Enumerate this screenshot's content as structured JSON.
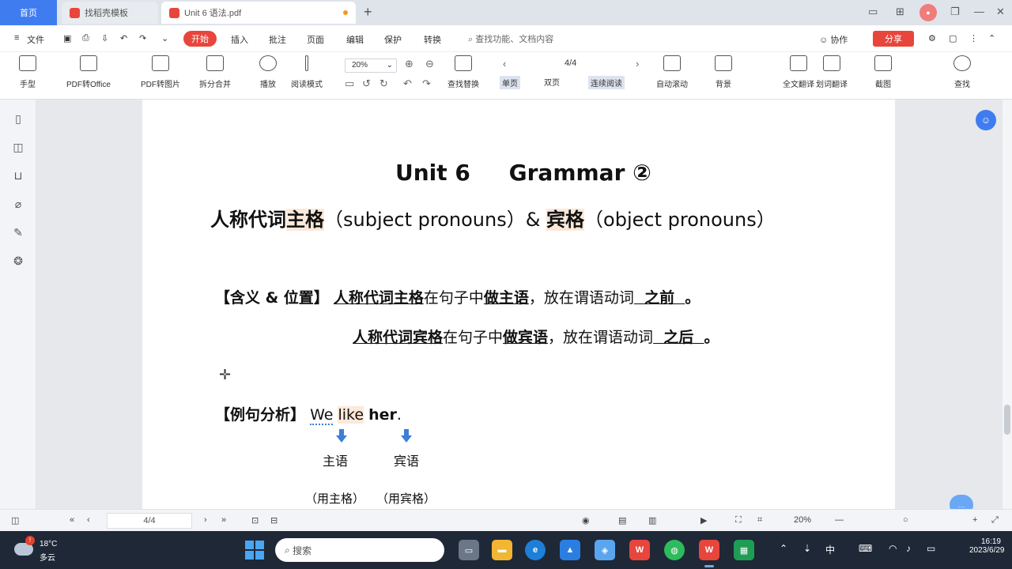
{
  "tabs": [
    {
      "label": "首页"
    },
    {
      "label": "找稻壳模板"
    },
    {
      "label": "Unit 6 语法.pdf"
    }
  ],
  "menu": {
    "items": [
      "文件",
      "开始",
      "插入",
      "批注",
      "页面",
      "编辑",
      "保护",
      "转换"
    ],
    "active_item": "开始",
    "search_placeholder": "查找功能、文档内容",
    "collab_label": "协作",
    "share_label": "分享"
  },
  "ribbon": {
    "buttons": [
      {
        "label": "手型"
      },
      {
        "label": "PDF转Office"
      },
      {
        "label": "PDF转图片"
      },
      {
        "label": "拆分合并"
      },
      {
        "label": "播放"
      },
      {
        "label": "阅读模式"
      },
      {
        "label": "查找替换"
      },
      {
        "label": "单页"
      },
      {
        "label": "双页"
      },
      {
        "label": "连续阅读"
      },
      {
        "label": "自动滚动"
      },
      {
        "label": "背景"
      },
      {
        "label": "全文翻译"
      },
      {
        "label": "划词翻译"
      },
      {
        "label": "截图"
      },
      {
        "label": "查找"
      }
    ],
    "zoom_value": "20%",
    "page_indicator": "4/4"
  },
  "document": {
    "title_unit": "Unit 6",
    "title_grammar": "Grammar ②",
    "subtitle": {
      "part1_plain": "人称代词",
      "part1_hl": "主格",
      "part1_en": "（subject pronouns）& ",
      "part2_hl": "宾格",
      "part2_en": "（object pronouns）"
    },
    "line1": {
      "tag": "【含义 & 位置】",
      "term": "人称代词主格",
      "mid": "在句子中",
      "role": "做主语",
      "tail": "，放在谓语动词",
      "blank": "  之前  ",
      "end": "。"
    },
    "line2": {
      "term": "人称代词宾格",
      "mid": "在句子中",
      "role": "做宾语",
      "tail": "，放在谓语动词",
      "blank": "  之后  ",
      "end": "。"
    },
    "example": {
      "tag": "【例句分析】",
      "w1": "We",
      "w2": "like",
      "w3": "her",
      "dot": ".",
      "label1": "主语",
      "label2": "宾语",
      "note1": "（用主格）",
      "note2": "（用宾格）"
    }
  },
  "statusbar": {
    "page_box": "4/4",
    "zoom": "20%"
  },
  "taskbar": {
    "temperature": "18°C",
    "weather": "多云",
    "search_placeholder": "搜索",
    "time": "16:19",
    "date": "2023/6/29"
  },
  "colors": {
    "accent_red": "#e8453c",
    "accent_blue": "#3f7cf0",
    "highlight": "#fde9d9"
  }
}
